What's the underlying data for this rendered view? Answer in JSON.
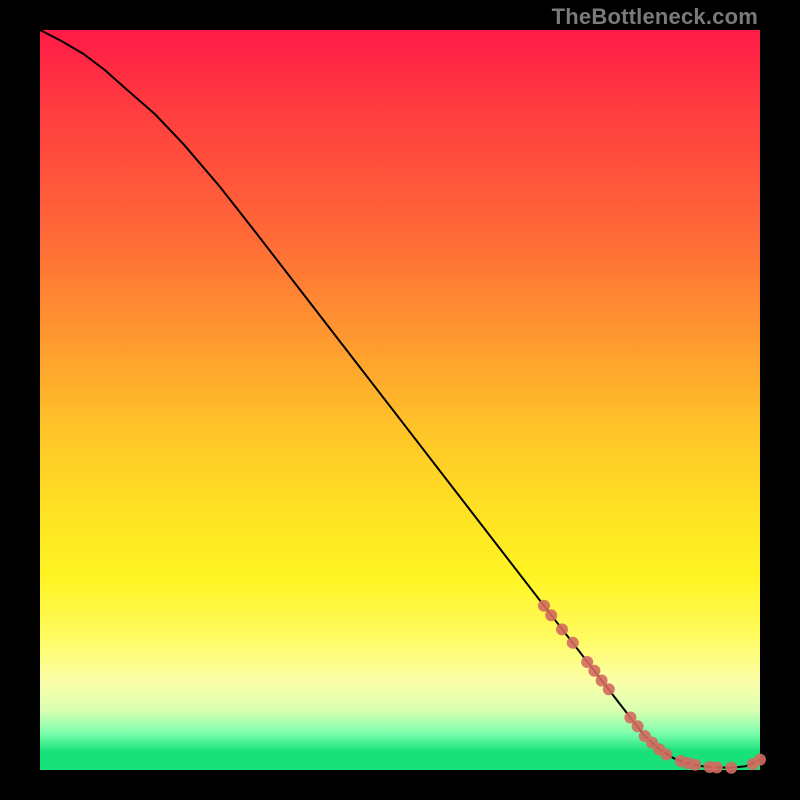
{
  "watermark": "TheBottleneck.com",
  "chart_data": {
    "type": "line",
    "title": "",
    "xlabel": "",
    "ylabel": "",
    "xlim": [
      0,
      100
    ],
    "ylim": [
      0,
      100
    ],
    "grid": false,
    "series": [
      {
        "name": "curve",
        "x": [
          0,
          3,
          6,
          9,
          12,
          16,
          20,
          25,
          30,
          35,
          40,
          45,
          50,
          55,
          60,
          65,
          70,
          75,
          80,
          84,
          86,
          88,
          90,
          92,
          94,
          96,
          98,
          100
        ],
        "y": [
          100,
          98.5,
          96.8,
          94.6,
          92,
          88.6,
          84.5,
          78.8,
          72.6,
          66.3,
          60,
          53.7,
          47.4,
          41.1,
          34.8,
          28.5,
          22.2,
          15.9,
          9.6,
          4.6,
          2.8,
          1.6,
          0.9,
          0.5,
          0.35,
          0.3,
          0.5,
          1.4
        ]
      },
      {
        "name": "markers",
        "type": "scatter",
        "x": [
          70,
          71,
          72.5,
          74,
          76,
          77,
          78,
          79,
          82,
          83,
          84,
          85,
          86,
          87,
          89,
          90,
          91,
          93,
          94,
          96,
          99,
          100
        ],
        "y": [
          22.2,
          20.9,
          19.0,
          17.2,
          14.6,
          13.4,
          12.1,
          10.9,
          7.1,
          5.9,
          4.6,
          3.7,
          2.8,
          2.1,
          1.2,
          0.9,
          0.7,
          0.4,
          0.35,
          0.3,
          0.8,
          1.4
        ]
      }
    ],
    "colors": {
      "curve": "#000000",
      "markers": "#d46a5f"
    }
  }
}
